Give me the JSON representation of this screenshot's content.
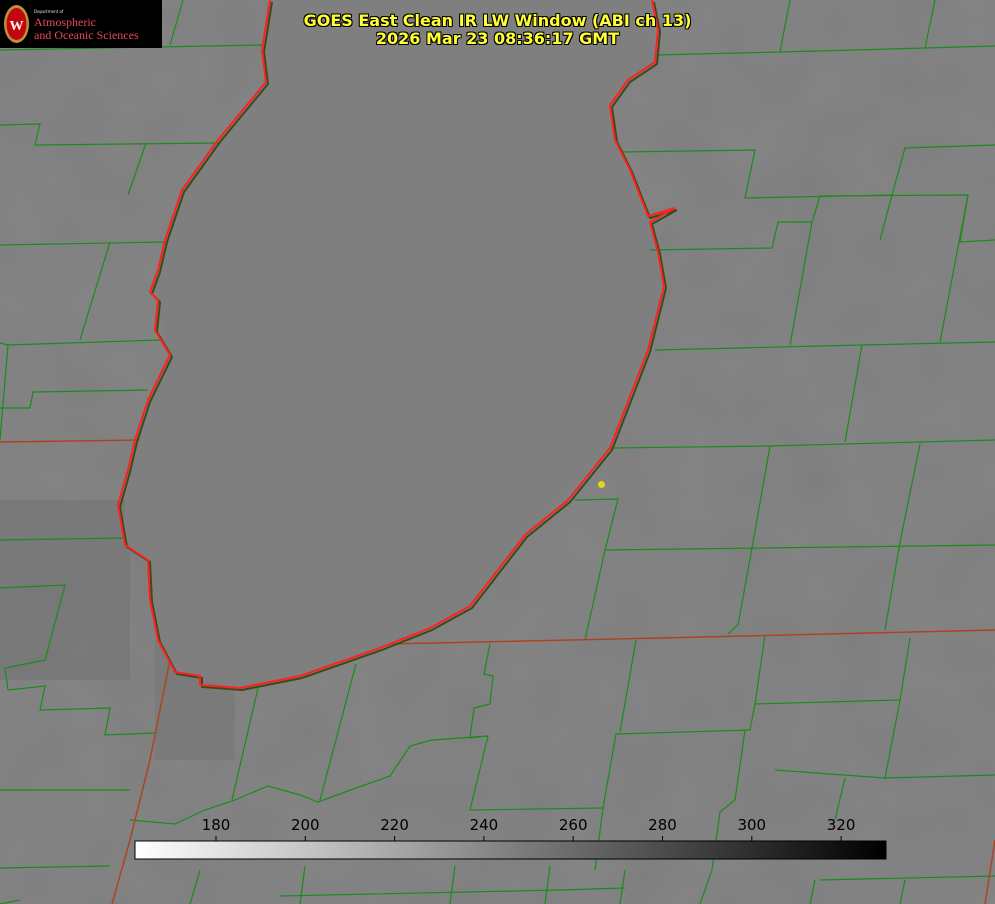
{
  "header": {
    "title_line1": "GOES East Clean IR LW Window (ABI ch 13)",
    "title_line2": "2026 Mar 23 08:36:17 GMT"
  },
  "logo": {
    "department_small": "Department of",
    "line1": "Atmospheric",
    "line2": "and Oceanic Sciences",
    "seal_letter": "W"
  },
  "colorbar": {
    "tick_labels": [
      "180",
      "200",
      "220",
      "240",
      "260",
      "280",
      "300",
      "320"
    ],
    "gradient_start": "#ffffff",
    "gradient_end": "#000000"
  },
  "colors": {
    "background_gray": "#7d7d7d",
    "county_lines": "#1a8c1a",
    "lake_shore": "#ff2020",
    "state_line": "#b04020",
    "title_text": "#ffff33",
    "marker": "#e6d21a"
  }
}
